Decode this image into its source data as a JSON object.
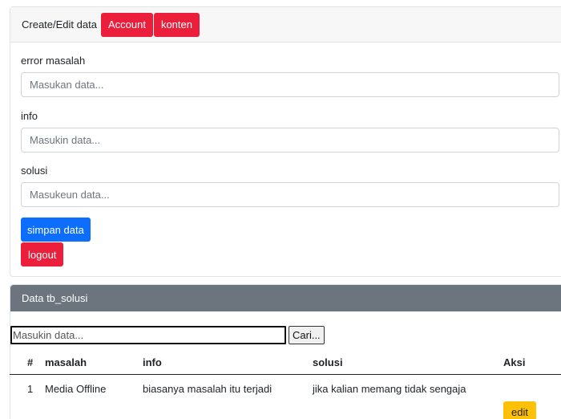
{
  "form_card": {
    "header_title": "Create/Edit data",
    "account_button": "Account",
    "konten_button": "konten",
    "fields": [
      {
        "label": "error masalah",
        "placeholder": "Masukan data..."
      },
      {
        "label": "info",
        "placeholder": "Masukin data..."
      },
      {
        "label": "solusi",
        "placeholder": "Masukeun data..."
      }
    ],
    "save_button": "simpan data",
    "logout_button": "logout"
  },
  "table_card": {
    "header_title": "Data tb_solusi",
    "search_placeholder": "Masukin data...",
    "search_button": "Cari...",
    "columns": [
      "#",
      "masalah",
      "info",
      "solusi",
      "Aksi"
    ],
    "rows": [
      {
        "no": "1",
        "masalah": "Media Offline",
        "info": "biasanya masalah itu terjadi",
        "solusi": "jika kalian memang tidak sengaja",
        "action": "edit"
      }
    ]
  },
  "colors": {
    "red": "#eb1f3b",
    "blue": "#0d6efd",
    "yellow": "#ffc107",
    "gray_header": "#6c757d"
  }
}
